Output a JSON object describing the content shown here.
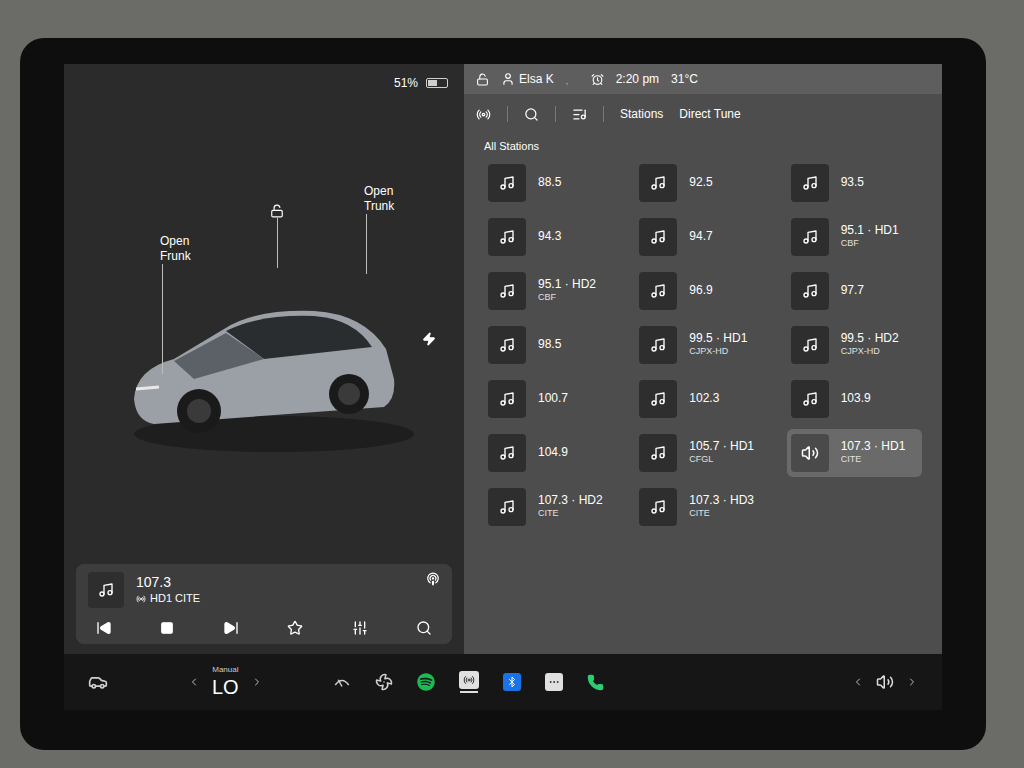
{
  "status": {
    "battery": "51%",
    "battery_level": 0.51,
    "user": "Elsa K",
    "time": "2:20 pm",
    "temperature": "31°C"
  },
  "car": {
    "frunk_label": "Open Frunk",
    "trunk_label": "Open Trunk",
    "unlocked": true,
    "charging": true
  },
  "now_playing": {
    "frequency": "107.3",
    "station": "HD1 CITE"
  },
  "radio": {
    "tabs": [
      {
        "label": "Stations"
      },
      {
        "label": "Direct Tune"
      }
    ],
    "section": "All Stations",
    "stations": [
      {
        "frequency": "88.5",
        "selected": false
      },
      {
        "frequency": "92.5",
        "selected": false
      },
      {
        "frequency": "93.5",
        "selected": false
      },
      {
        "frequency": "94.3",
        "selected": false
      },
      {
        "frequency": "94.7",
        "selected": false
      },
      {
        "frequency": "95.1 · HD1",
        "callsign": "CBF",
        "selected": false
      },
      {
        "frequency": "95.1 · HD2",
        "callsign": "CBF",
        "selected": false
      },
      {
        "frequency": "96.9",
        "selected": false
      },
      {
        "frequency": "97.7",
        "selected": false
      },
      {
        "frequency": "98.5",
        "selected": false
      },
      {
        "frequency": "99.5 · HD1",
        "callsign": "CJPX-HD",
        "selected": false
      },
      {
        "frequency": "99.5 · HD2",
        "callsign": "CJPX-HD",
        "selected": false
      },
      {
        "frequency": "100.7",
        "selected": false
      },
      {
        "frequency": "102.3",
        "selected": false
      },
      {
        "frequency": "103.9",
        "selected": false
      },
      {
        "frequency": "104.9",
        "selected": false
      },
      {
        "frequency": "105.7 · HD1",
        "callsign": "CFGL",
        "selected": false
      },
      {
        "frequency": "107.3 · HD1",
        "callsign": "CITE",
        "selected": true
      },
      {
        "frequency": "107.3 · HD2",
        "callsign": "CITE",
        "selected": false
      },
      {
        "frequency": "107.3 · HD3",
        "callsign": "CITE",
        "selected": false
      }
    ]
  },
  "climate": {
    "mode": "Manual",
    "temperature": "LO"
  }
}
